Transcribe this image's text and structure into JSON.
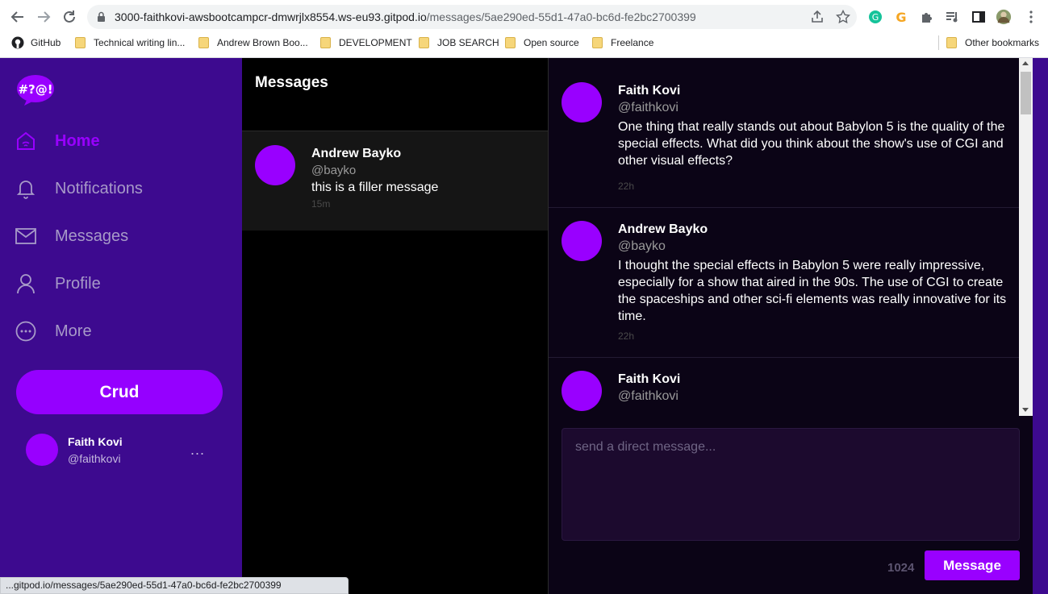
{
  "browser": {
    "url_host": "3000-faithkovi-awsbootcampcr-dmwrjlx8554.ws-eu93.gitpod.io",
    "url_path": "/messages/5ae290ed-55d1-47a0-bc6d-fe2bc2700399",
    "bookmarks": [
      {
        "label": "GitHub",
        "icon": "github-icon"
      },
      {
        "label": "Technical writing lin...",
        "icon": "folder-icon"
      },
      {
        "label": "Andrew Brown Boo...",
        "icon": "folder-icon"
      },
      {
        "label": "DEVELOPMENT",
        "icon": "folder-icon"
      },
      {
        "label": "JOB SEARCH",
        "icon": "folder-icon"
      },
      {
        "label": "Open source",
        "icon": "folder-icon"
      },
      {
        "label": "Freelance",
        "icon": "folder-icon"
      }
    ],
    "other_bookmarks": "Other bookmarks",
    "status_text": "...gitpod.io/messages/5ae290ed-55d1-47a0-bc6d-fe2bc2700399"
  },
  "sidebar": {
    "logo_text": "#?@!",
    "items": [
      {
        "label": "Home",
        "icon": "home-icon",
        "active": true
      },
      {
        "label": "Notifications",
        "icon": "bell-icon",
        "active": false
      },
      {
        "label": "Messages",
        "icon": "envelope-icon",
        "active": false
      },
      {
        "label": "Profile",
        "icon": "person-icon",
        "active": false
      },
      {
        "label": "More",
        "icon": "more-circle-icon",
        "active": false
      }
    ],
    "crud_label": "Crud",
    "user": {
      "name": "Faith Kovi",
      "handle": "@faithkovi",
      "menu": "..."
    }
  },
  "groups": {
    "title": "Messages",
    "items": [
      {
        "name": "Andrew Bayko",
        "handle": "@bayko",
        "message": "this is a filler message",
        "time": "15m"
      }
    ]
  },
  "thread": {
    "messages": [
      {
        "name": "Faith Kovi",
        "handle": "@faithkovi",
        "text": "One thing that really stands out about Babylon 5 is the quality of the special effects. What did you think about the show's use of CGI and other visual effects?",
        "time": "22h"
      },
      {
        "name": "Andrew Bayko",
        "handle": "@bayko",
        "text": "I thought the special effects in Babylon 5 were really impressive, especially for a show that aired in the 90s. The use of CGI to create the spaceships and other sci-fi elements was really innovative for its time.",
        "time": "22h"
      },
      {
        "name": "Faith Kovi",
        "handle": "@faithkovi",
        "text": "",
        "time": ""
      }
    ],
    "composer_placeholder": "send a direct message...",
    "char_count": "1024",
    "send_label": "Message"
  },
  "colors": {
    "accent": "#9900ff",
    "sidebar_bg": "#3d0a8f",
    "thread_bg": "#0b0416"
  }
}
